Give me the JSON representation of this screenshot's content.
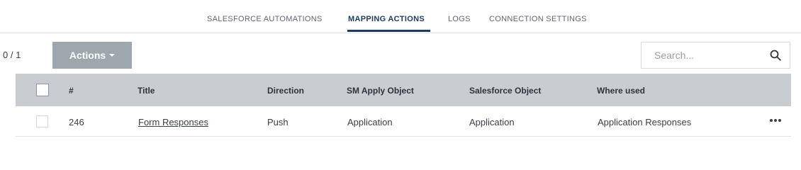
{
  "tabs": [
    {
      "label": "SALESFORCE AUTOMATIONS",
      "active": false
    },
    {
      "label": "MAPPING ACTIONS",
      "active": true
    },
    {
      "label": "LOGS",
      "active": false
    },
    {
      "label": "CONNECTION SETTINGS",
      "active": false
    }
  ],
  "toolbar": {
    "count": "0 / 1",
    "actions_label": "Actions",
    "actions_icon": "caret-down-icon",
    "search_placeholder": "Search...",
    "search_icon": "search-icon"
  },
  "table": {
    "headers": [
      "#",
      "Title",
      "Direction",
      "SM Apply Object",
      "Salesforce Object",
      "Where used"
    ],
    "rows": [
      {
        "id": "246",
        "title": "Form Responses",
        "direction": "Push",
        "sm_apply_object": "Application",
        "salesforce_object": "Application",
        "where_used": "Application Responses",
        "menu_icon": "more-horizontal-icon"
      }
    ]
  },
  "colors": {
    "accent": "#1e3a5f",
    "header_bg": "#c9ccd0",
    "button_bg": "#a0a6ad"
  }
}
